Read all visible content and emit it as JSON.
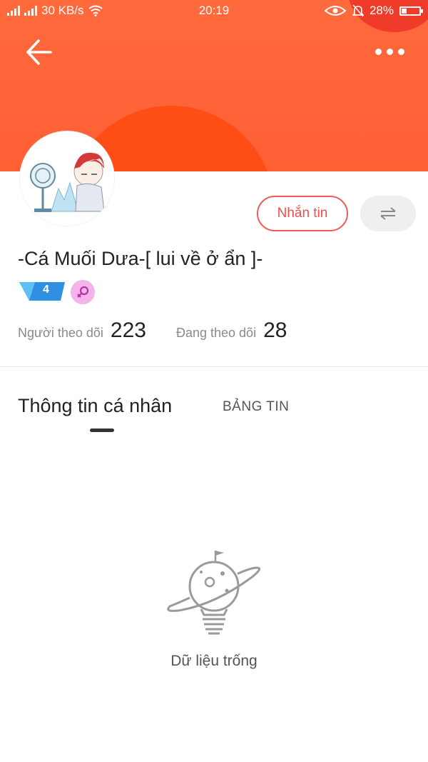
{
  "status_bar": {
    "network_speed": "30 KB/s",
    "time": "20:19",
    "battery_percent": "28%",
    "battery_level": 0.28,
    "icons": [
      "signal-icon",
      "signal-icon",
      "wifi-icon",
      "eye-icon",
      "bell-muted-icon",
      "battery-icon"
    ]
  },
  "header": {
    "back_icon": "arrow-left-icon",
    "more_icon": "more-dots-icon",
    "banner_color": "#ff6a3d"
  },
  "profile": {
    "name": "-Cá Muối Dưa-[ lui về ở ẩn ]-",
    "level": "4",
    "gender_icon": "female-icon",
    "message_button": "Nhắn tin",
    "switch_icon": "swap-arrows-icon",
    "followers_label": "Người theo dõi",
    "followers_count": "223",
    "following_label": "Đang theo dõi",
    "following_count": "28"
  },
  "tabs": [
    {
      "label": "Thông tin cá nhân",
      "active": true
    },
    {
      "label": "BẢNG TIN",
      "active": false
    }
  ],
  "empty_state": {
    "icon": "planet-bulb-icon",
    "text": "Dữ liệu trống"
  },
  "colors": {
    "accent": "#ef4d4d",
    "banner": "#ff6a3d",
    "sun": "#ff4d16"
  }
}
